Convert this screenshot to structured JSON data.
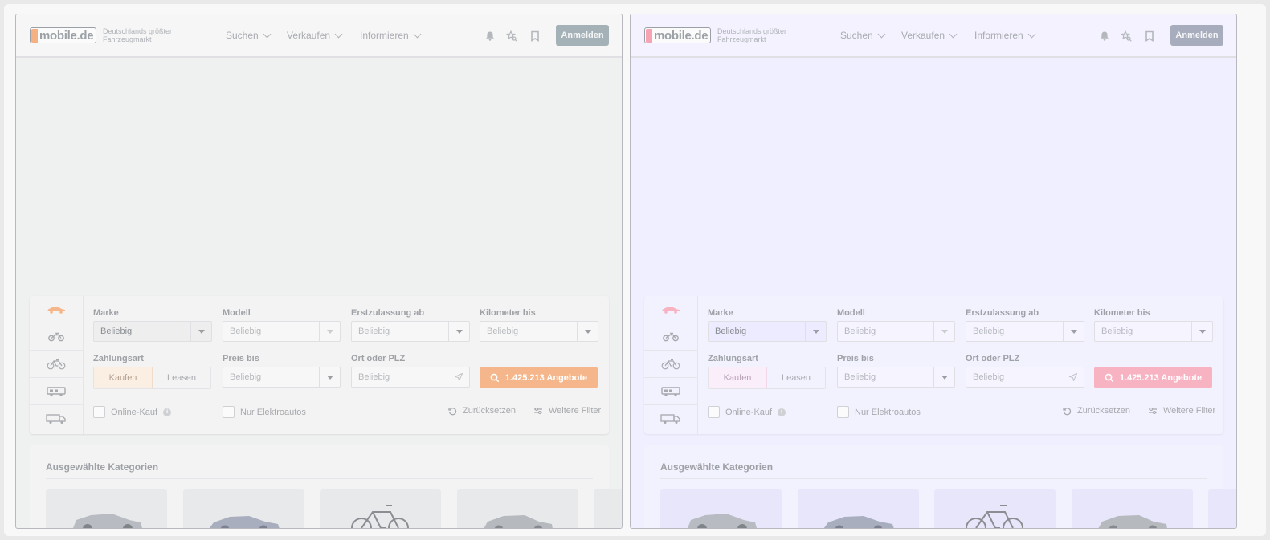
{
  "header": {
    "logo_text": "mobile.de",
    "tagline": "Deutschlands größter Fahrzeugmarkt",
    "nav": [
      {
        "label": "Suchen"
      },
      {
        "label": "Verkaufen"
      },
      {
        "label": "Informieren"
      }
    ],
    "icons": [
      "bell-icon",
      "star-search-icon",
      "bookmark-icon"
    ],
    "login_label": "Anmelden"
  },
  "search": {
    "vehicle_tabs": [
      "car-icon",
      "motorbike-icon",
      "bicycle-icon",
      "motorhome-icon",
      "truck-icon"
    ],
    "fields": {
      "make": {
        "label": "Marke",
        "value": "Beliebig"
      },
      "model": {
        "label": "Modell",
        "value": "Beliebig"
      },
      "first_registration": {
        "label": "Erstzulassung ab",
        "value": "Beliebig"
      },
      "mileage": {
        "label": "Kilometer bis",
        "value": "Beliebig"
      },
      "payment": {
        "label": "Zahlungsart",
        "options": [
          "Kaufen",
          "Leasen"
        ],
        "selected": "Kaufen"
      },
      "price": {
        "label": "Preis bis",
        "value": "Beliebig"
      },
      "location": {
        "label": "Ort oder PLZ",
        "placeholder": "Beliebig"
      }
    },
    "submit_label": "1.425.213 Angebote",
    "online_purchase_label": "Online-Kauf",
    "electric_only_label": "Nur Elektroautos",
    "reset_label": "Zurücksetzen",
    "more_filters_label": "Weitere Filter"
  },
  "categories": {
    "title": "Ausgewählte Kategorien",
    "cards": [
      "suv-car",
      "sedan-car",
      "e-bike",
      "hatchback-car"
    ]
  },
  "colors": {
    "accent_left": "#f4b68a",
    "accent_right": "#f8b3c3",
    "panel_left_bg": "#eff0f0",
    "panel_right_bg": "#f0efff"
  }
}
